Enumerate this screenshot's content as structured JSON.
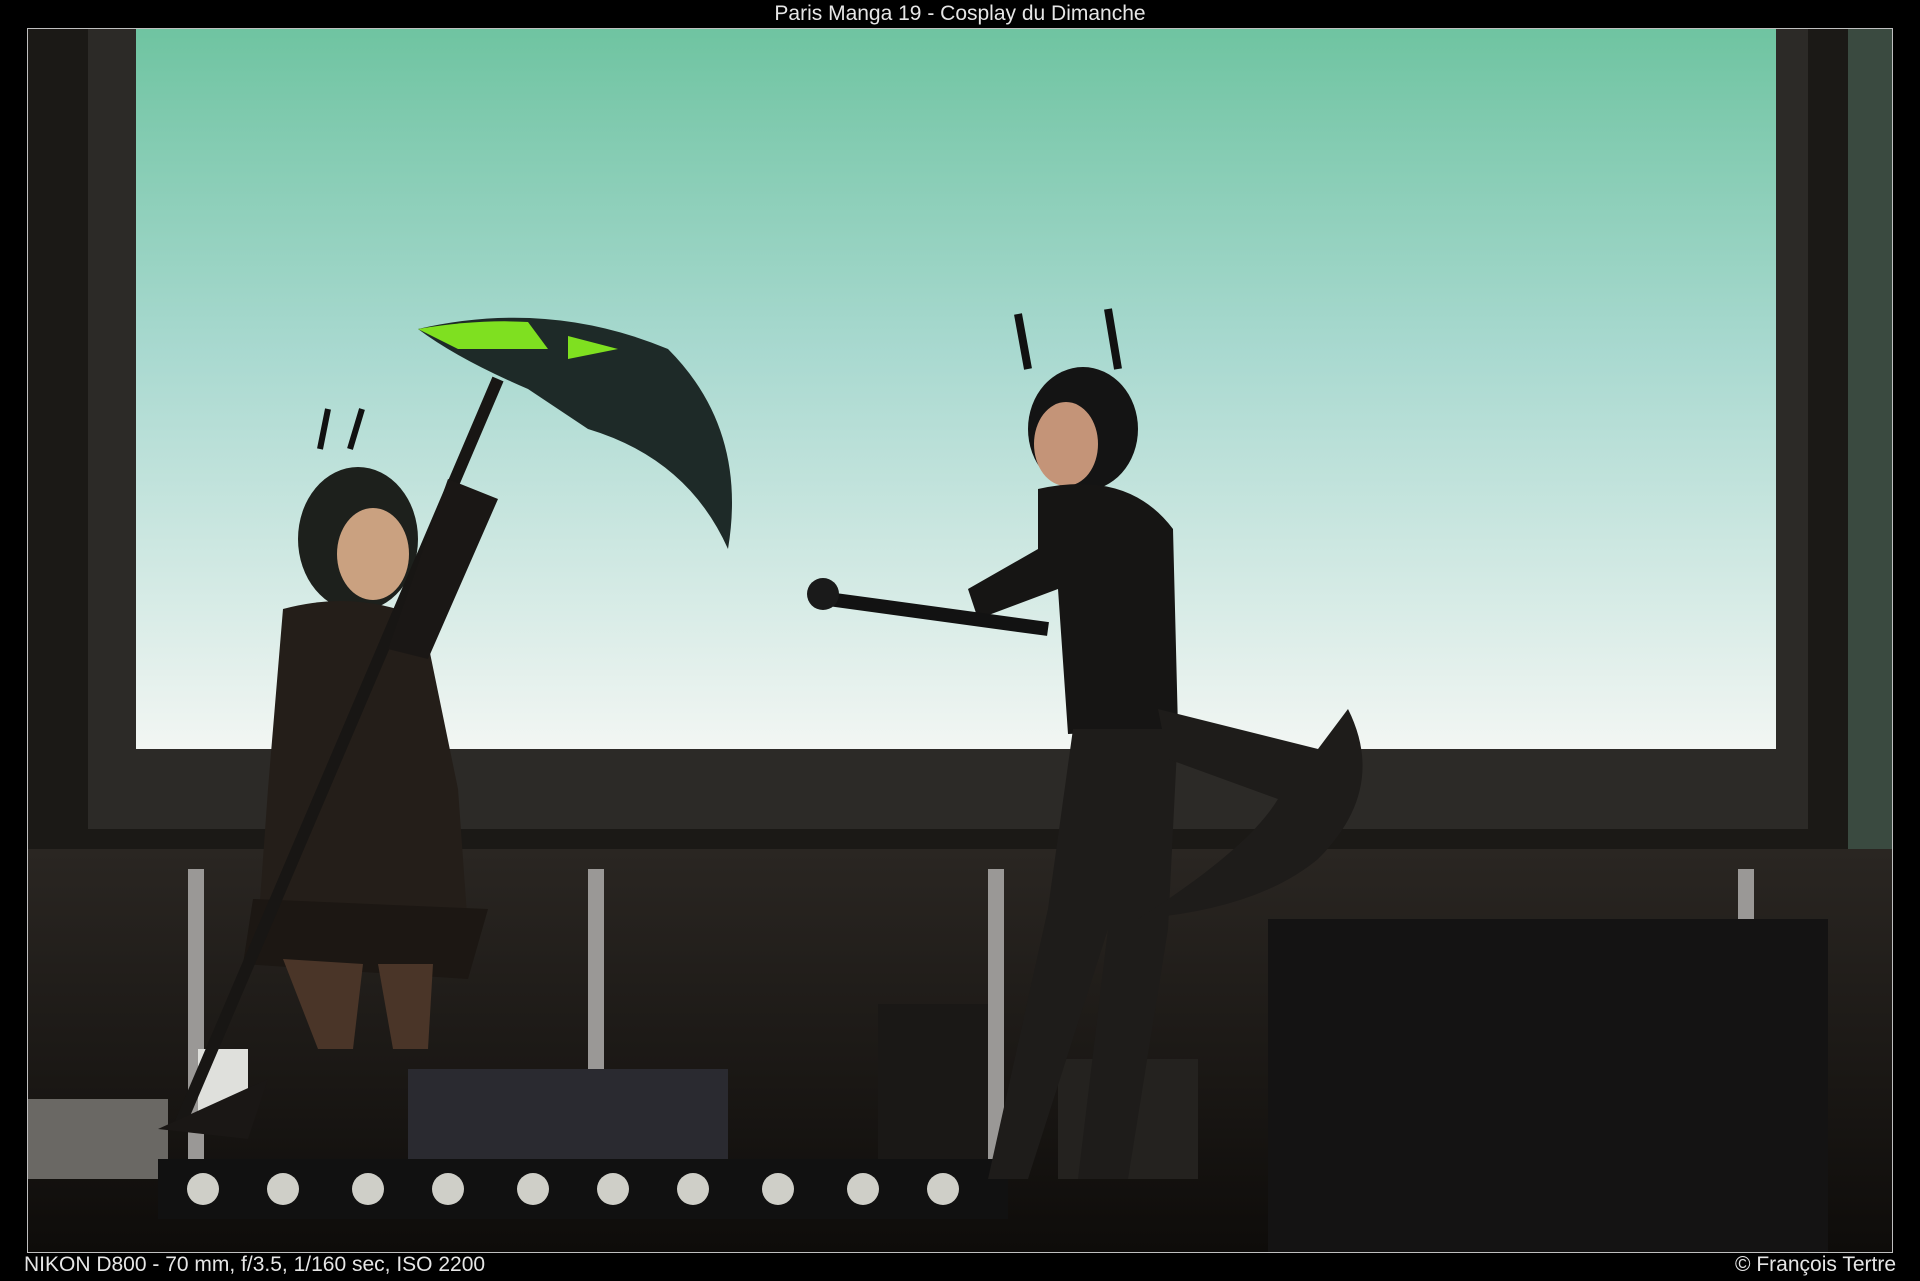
{
  "header": {
    "title": "Paris Manga 19 - Cosplay du Dimanche"
  },
  "footer": {
    "exif": "NIKON D800 - 70 mm, f/3.5, 1/160 sec, ISO 2200",
    "credit": "© François Tertre"
  },
  "photo": {
    "screen_top_color": "#6fc4a1",
    "screen_bottom_color": "#f2f6f3",
    "blade_accent_color": "#7fe020"
  }
}
